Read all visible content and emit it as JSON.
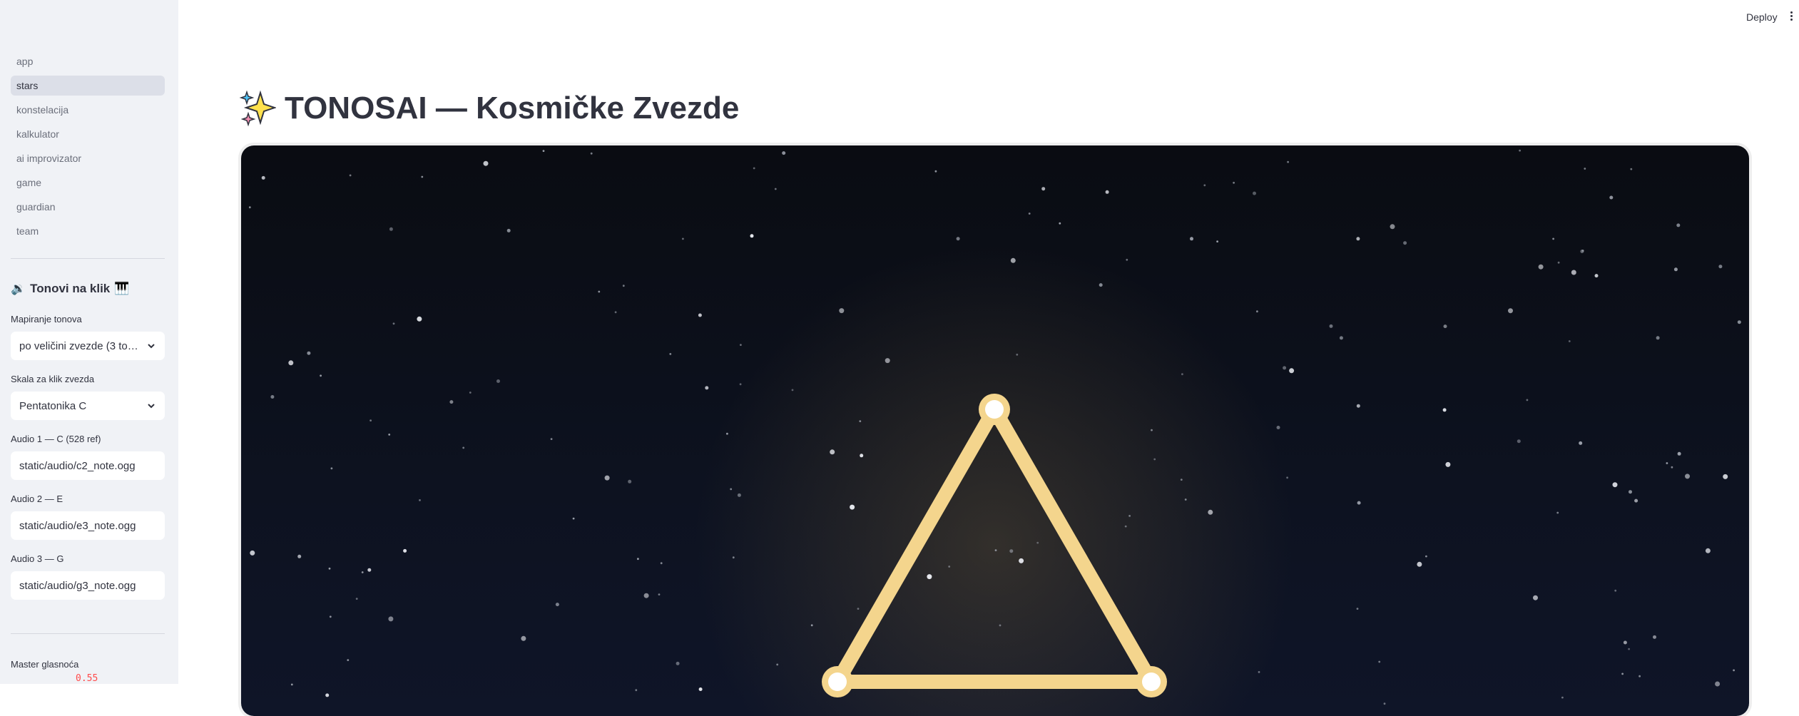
{
  "sidebar": {
    "nav": [
      {
        "label": "app",
        "active": false
      },
      {
        "label": "stars",
        "active": true
      },
      {
        "label": "konstelacija",
        "active": false
      },
      {
        "label": "kalkulator",
        "active": false
      },
      {
        "label": "ai improvizator",
        "active": false
      },
      {
        "label": "game",
        "active": false
      },
      {
        "label": "guardian",
        "active": false
      },
      {
        "label": "team",
        "active": false
      }
    ],
    "section_title": "Tonovi na klik",
    "mapping_label": "Mapiranje tonova",
    "mapping_value": "po veličini zvezde (3 tona)",
    "scale_label": "Skala za klik zvezda",
    "scale_value": "Pentatonika C",
    "audio1_label": "Audio 1 — C (528 ref)",
    "audio1_value": "static/audio/c2_note.ogg",
    "audio2_label": "Audio 2 — E",
    "audio2_value": "static/audio/e3_note.ogg",
    "audio3_label": "Audio 3 — G",
    "audio3_value": "static/audio/g3_note.ogg",
    "volume_label": "Master glasnoća",
    "volume_value": "0.55"
  },
  "header": {
    "deploy_label": "Deploy"
  },
  "main": {
    "title": "TONOSAI — Kosmičke Zvezde"
  },
  "colors": {
    "accent": "#ff4b4b",
    "constellation": "#f4d58d",
    "sidebar_bg": "#f0f2f6"
  }
}
